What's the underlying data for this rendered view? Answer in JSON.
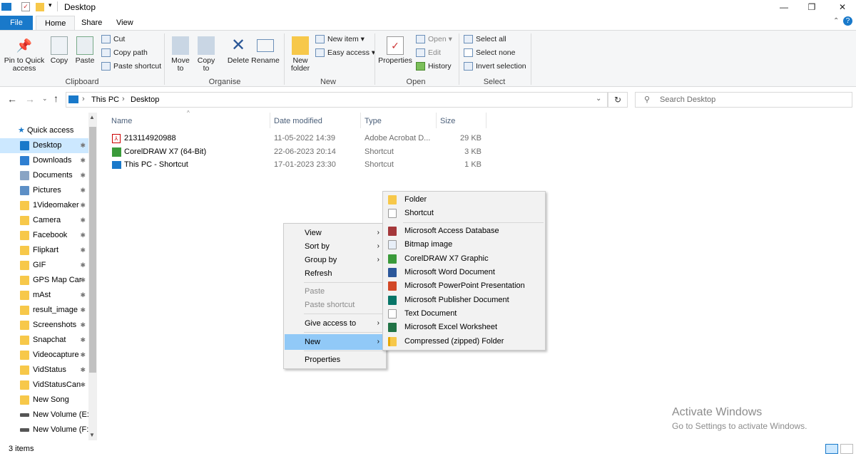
{
  "window": {
    "title": "Desktop"
  },
  "tabs": [
    {
      "label": "File"
    },
    {
      "label": "Home"
    },
    {
      "label": "Share"
    },
    {
      "label": "View"
    }
  ],
  "ribbon": {
    "clipboard": {
      "label": "Clipboard",
      "pin": "Pin to Quick access",
      "copy": "Copy",
      "paste": "Paste",
      "cut": "Cut",
      "copy_path": "Copy path",
      "paste_shortcut": "Paste shortcut"
    },
    "organise": {
      "label": "Organise",
      "move_to": "Move to",
      "copy_to": "Copy to",
      "delete": "Delete",
      "rename": "Rename"
    },
    "new": {
      "label": "New",
      "new_folder": "New folder",
      "new_item": "New item",
      "easy_access": "Easy access"
    },
    "open": {
      "label": "Open",
      "properties": "Properties",
      "open": "Open",
      "edit": "Edit",
      "history": "History"
    },
    "select": {
      "label": "Select",
      "select_all": "Select all",
      "select_none": "Select none",
      "invert": "Invert selection"
    }
  },
  "address": {
    "path": [
      "This PC",
      "Desktop"
    ],
    "search_placeholder": "Search Desktop"
  },
  "nav": {
    "quick_access": "Quick access",
    "items": [
      {
        "label": "Desktop",
        "pinned": true
      },
      {
        "label": "Downloads",
        "pinned": true
      },
      {
        "label": "Documents",
        "pinned": true
      },
      {
        "label": "Pictures",
        "pinned": true
      },
      {
        "label": "1Videomaker",
        "pinned": true
      },
      {
        "label": "Camera",
        "pinned": true
      },
      {
        "label": "Facebook",
        "pinned": true
      },
      {
        "label": "Flipkart",
        "pinned": true
      },
      {
        "label": "GIF",
        "pinned": true
      },
      {
        "label": "GPS Map Car",
        "pinned": true
      },
      {
        "label": "mAst",
        "pinned": true
      },
      {
        "label": "result_image",
        "pinned": true
      },
      {
        "label": "Screenshots",
        "pinned": true
      },
      {
        "label": "Snapchat",
        "pinned": true
      },
      {
        "label": "Videocapture",
        "pinned": true
      },
      {
        "label": "VidStatus",
        "pinned": true
      },
      {
        "label": "VidStatusCan",
        "pinned": true
      },
      {
        "label": "New Song",
        "pinned": false
      },
      {
        "label": "New Volume (E:)",
        "pinned": false
      },
      {
        "label": "New Volume (F:)",
        "pinned": false
      }
    ]
  },
  "columns": {
    "name": "Name",
    "date": "Date modified",
    "type": "Type",
    "size": "Size"
  },
  "files": [
    {
      "name": "213114920988",
      "date": "11-05-2022 14:39",
      "type": "Adobe Acrobat D...",
      "size": "29 KB"
    },
    {
      "name": "CorelDRAW X7 (64-Bit)",
      "date": "22-06-2023 20:14",
      "type": "Shortcut",
      "size": "3 KB"
    },
    {
      "name": "This PC - Shortcut",
      "date": "17-01-2023 23:30",
      "type": "Shortcut",
      "size": "1 KB"
    }
  ],
  "context_menu": {
    "view": "View",
    "sort_by": "Sort by",
    "group_by": "Group by",
    "refresh": "Refresh",
    "paste": "Paste",
    "paste_shortcut": "Paste shortcut",
    "give_access": "Give access to",
    "new": "New",
    "properties": "Properties"
  },
  "new_submenu": [
    "Folder",
    "Shortcut",
    "Microsoft Access Database",
    "Bitmap image",
    "CorelDRAW X7 Graphic",
    "Microsoft Word Document",
    "Microsoft PowerPoint Presentation",
    "Microsoft Publisher Document",
    "Text Document",
    "Microsoft Excel Worksheet",
    "Compressed (zipped) Folder"
  ],
  "status": {
    "items": "3 items"
  },
  "watermark": {
    "line1": "Activate Windows",
    "line2": "Go to Settings to activate Windows."
  },
  "colors": {
    "accent": "#1979ca",
    "selection": "#cce8ff",
    "menu_highlight": "#91c9f7"
  }
}
